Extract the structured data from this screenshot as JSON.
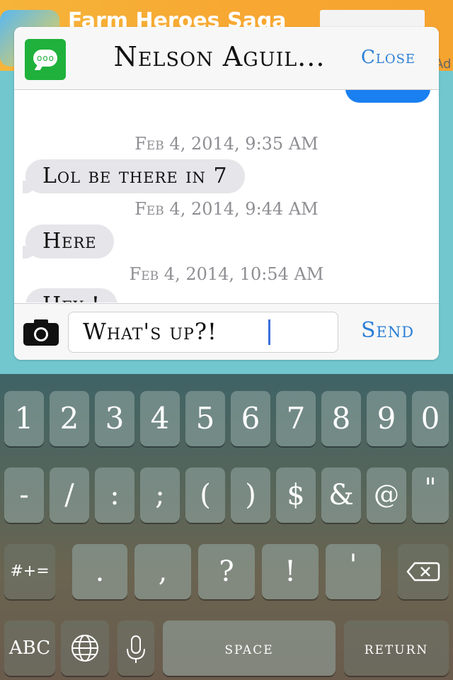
{
  "background_app": {
    "title": "Farm Heroes Saga",
    "ad_label": "Ad"
  },
  "popup": {
    "contact_name": "Nelson Aguil...",
    "close_label": "Close",
    "messages": [
      {
        "timestamp": "Feb 4, 2014, 9:35 AM",
        "text": "Lol be there in 7"
      },
      {
        "timestamp": "Feb 4, 2014, 9:44 AM",
        "text": "Here"
      },
      {
        "timestamp": "Feb 4, 2014, 10:54 AM",
        "text": "Hey !"
      }
    ],
    "compose": {
      "value": "What's up?!",
      "send_label": "Send"
    }
  },
  "keyboard": {
    "row1": [
      "1",
      "2",
      "3",
      "4",
      "5",
      "6",
      "7",
      "8",
      "9",
      "0"
    ],
    "row2": [
      "-",
      "/",
      ":",
      ";",
      "(",
      ")",
      "$",
      "&",
      "@",
      "\""
    ],
    "row3": {
      "symbols_key": "#+=",
      "keys": [
        ".",
        ",",
        "?",
        "!",
        "'"
      ],
      "delete_icon": "backspace-icon"
    },
    "row4": {
      "abc_key": "ABC",
      "globe_icon": "globe-icon",
      "mic_icon": "microphone-icon",
      "space_key": "space",
      "return_key": "return"
    }
  },
  "colors": {
    "accent_blue": "#2b7fd6",
    "sent_bubble": "#1a7ff0",
    "received_bubble": "#e5e5ea",
    "messages_green": "#1fb13b"
  }
}
